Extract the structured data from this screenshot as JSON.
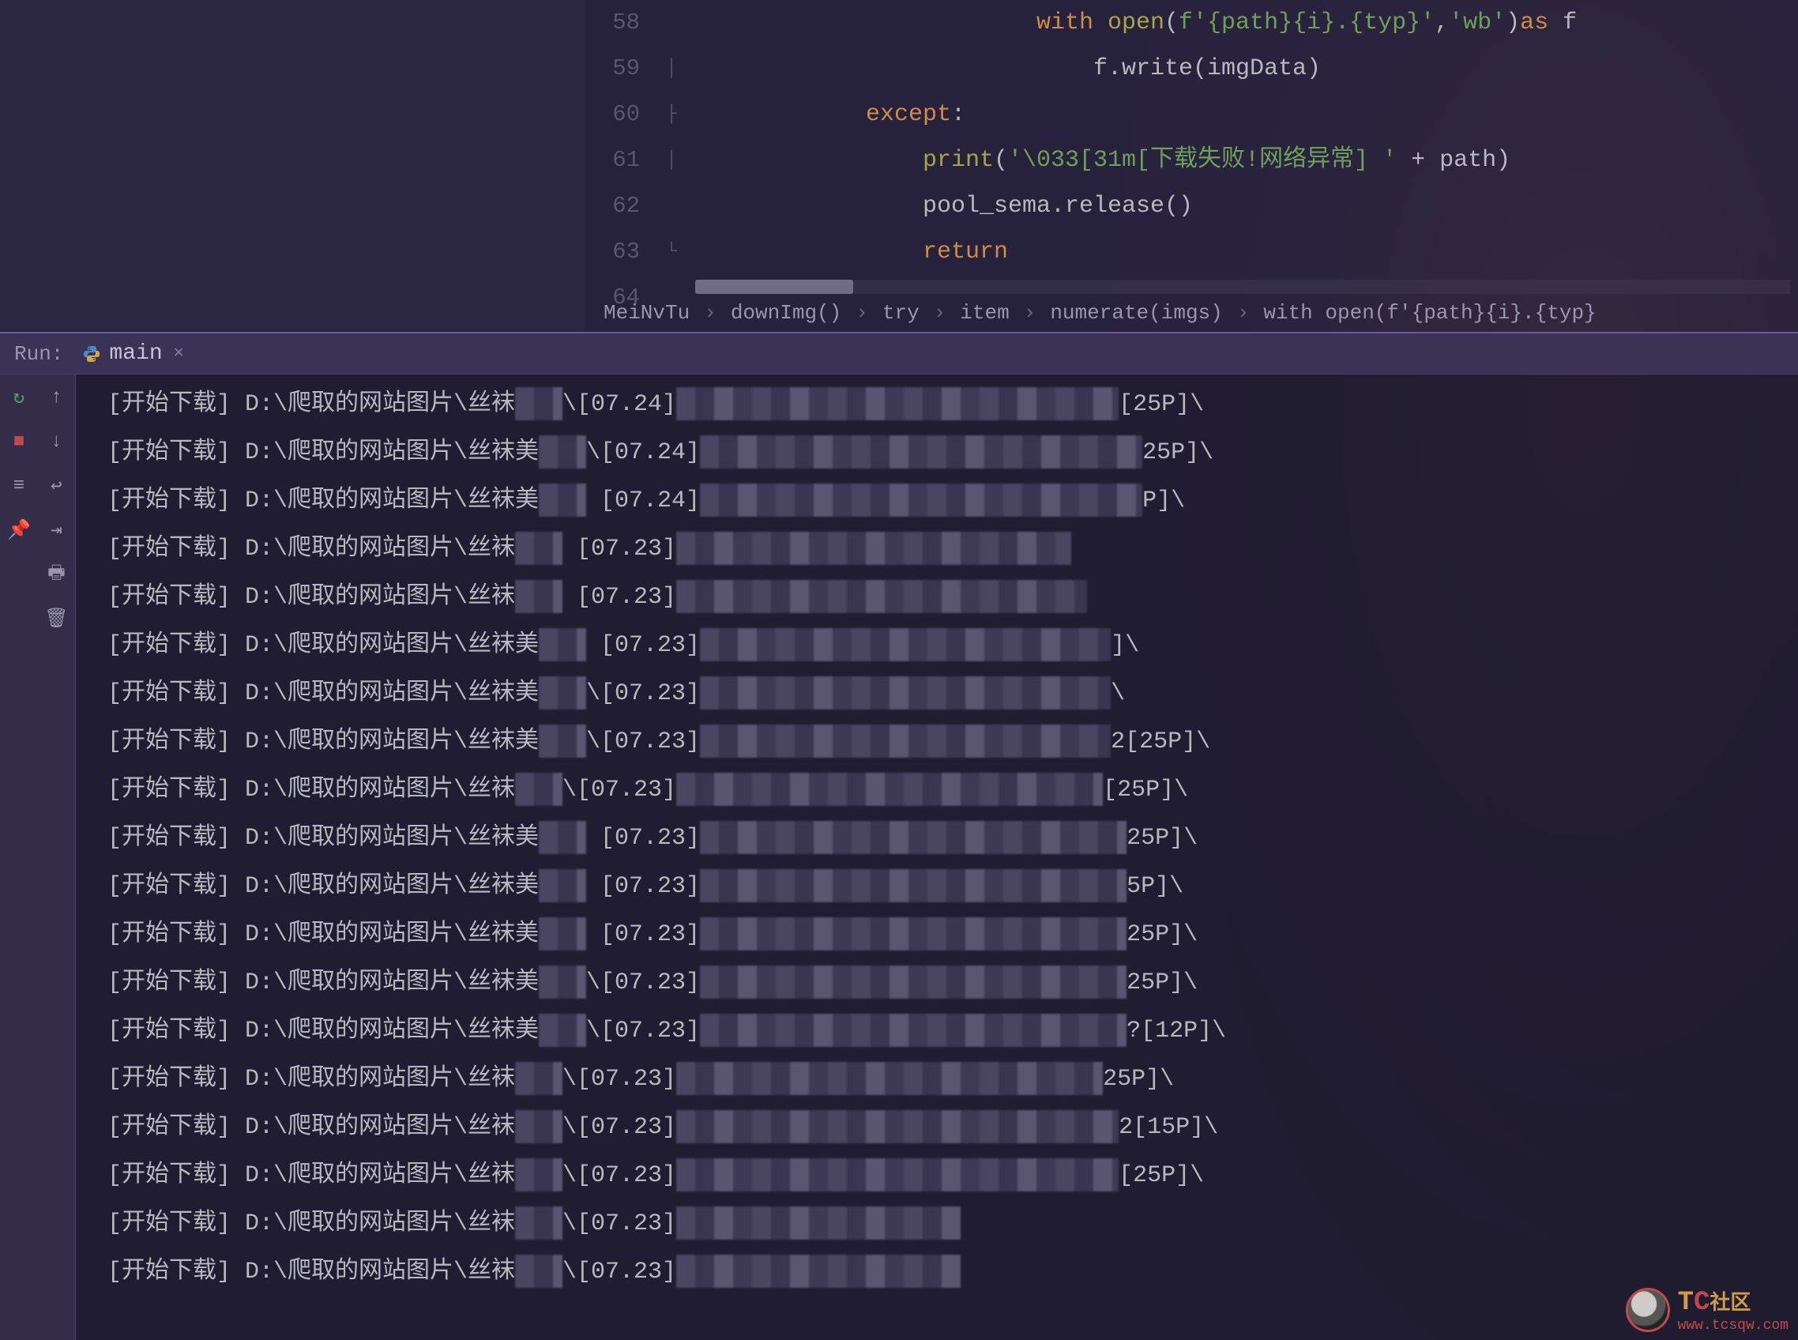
{
  "editor": {
    "lines": [
      {
        "num": "58",
        "fold": "",
        "indent": 24,
        "tokens": [
          {
            "t": "with ",
            "c": "kw"
          },
          {
            "t": "open",
            "c": "fn"
          },
          {
            "t": "(",
            "c": "id"
          },
          {
            "t": "f'{path}{i}.{typ}'",
            "c": "str"
          },
          {
            "t": ",",
            "c": "id"
          },
          {
            "t": "'wb'",
            "c": "str"
          },
          {
            "t": ")",
            "c": "id"
          },
          {
            "t": "as ",
            "c": "kw"
          },
          {
            "t": "f",
            "c": "id"
          }
        ]
      },
      {
        "num": "59",
        "fold": "│",
        "indent": 28,
        "tokens": [
          {
            "t": "f.write(imgData)",
            "c": "id"
          }
        ]
      },
      {
        "num": "60",
        "fold": "├",
        "indent": 12,
        "tokens": [
          {
            "t": "except",
            "c": "kw"
          },
          {
            "t": ":",
            "c": "id"
          }
        ]
      },
      {
        "num": "61",
        "fold": "│",
        "indent": 16,
        "tokens": [
          {
            "t": "print",
            "c": "fn"
          },
          {
            "t": "(",
            "c": "id"
          },
          {
            "t": "'\\033[31m[下载失败!网络异常] '",
            "c": "str"
          },
          {
            "t": " + path)",
            "c": "id"
          }
        ]
      },
      {
        "num": "62",
        "fold": "",
        "indent": 16,
        "tokens": [
          {
            "t": "pool_sema.release()",
            "c": "id"
          }
        ]
      },
      {
        "num": "63",
        "fold": "└",
        "indent": 16,
        "tokens": [
          {
            "t": "return",
            "c": "kw"
          }
        ]
      },
      {
        "num": "64",
        "fold": "",
        "indent": 0,
        "tokens": []
      }
    ],
    "breadcrumb": [
      "MeiNvTu",
      "downImg()",
      "try",
      "item",
      "numerate(imgs)",
      "with open(f'{path}{i}.{typ}"
    ]
  },
  "run": {
    "label": "Run:",
    "tab": "main",
    "lines": [
      {
        "prefix": "[开始下载] D:\\爬取的网站图片\\丝袜",
        "mid": "\\[07.24]",
        "cw": 560,
        "suffix": "[25P]\\"
      },
      {
        "prefix": "[开始下载] D:\\爬取的网站图片\\丝袜美",
        "mid": "\\[07.24]",
        "cw": 560,
        "suffix": "25P]\\"
      },
      {
        "prefix": "[开始下载] D:\\爬取的网站图片\\丝袜美",
        "mid": " [07.24]",
        "cw": 560,
        "suffix": "P]\\"
      },
      {
        "prefix": "[开始下载] D:\\爬取的网站图片\\丝袜",
        "mid": " [07.23]",
        "cw": 500,
        "suffix": ""
      },
      {
        "prefix": "[开始下载] D:\\爬取的网站图片\\丝袜",
        "mid": " [07.23]",
        "cw": 520,
        "suffix": ""
      },
      {
        "prefix": "[开始下载] D:\\爬取的网站图片\\丝袜美",
        "mid": " [07.23]",
        "cw": 520,
        "suffix": "]\\"
      },
      {
        "prefix": "[开始下载] D:\\爬取的网站图片\\丝袜美",
        "mid": "\\[07.23]",
        "cw": 520,
        "suffix": "\\"
      },
      {
        "prefix": "[开始下载] D:\\爬取的网站图片\\丝袜美",
        "mid": "\\[07.23]",
        "cw": 520,
        "suffix": "2[25P]\\"
      },
      {
        "prefix": "[开始下载] D:\\爬取的网站图片\\丝袜",
        "mid": "\\[07.23]",
        "cw": 540,
        "suffix": "[25P]\\"
      },
      {
        "prefix": "[开始下载] D:\\爬取的网站图片\\丝袜美",
        "mid": " [07.23]",
        "cw": 540,
        "suffix": "25P]\\"
      },
      {
        "prefix": "[开始下载] D:\\爬取的网站图片\\丝袜美",
        "mid": " [07.23]",
        "cw": 540,
        "suffix": "5P]\\"
      },
      {
        "prefix": "[开始下载] D:\\爬取的网站图片\\丝袜美",
        "mid": " [07.23]",
        "cw": 540,
        "suffix": "25P]\\"
      },
      {
        "prefix": "[开始下载] D:\\爬取的网站图片\\丝袜美",
        "mid": "\\[07.23]",
        "cw": 540,
        "suffix": "25P]\\"
      },
      {
        "prefix": "[开始下载] D:\\爬取的网站图片\\丝袜美",
        "mid": "\\[07.23]",
        "cw": 540,
        "suffix": "?[12P]\\"
      },
      {
        "prefix": "[开始下载] D:\\爬取的网站图片\\丝袜",
        "mid": "\\[07.23]",
        "cw": 540,
        "suffix": "25P]\\"
      },
      {
        "prefix": "[开始下载] D:\\爬取的网站图片\\丝袜",
        "mid": "\\[07.23]",
        "cw": 560,
        "suffix": "2[15P]\\"
      },
      {
        "prefix": "[开始下载] D:\\爬取的网站图片\\丝袜",
        "mid": "\\[07.23]",
        "cw": 560,
        "suffix": "[25P]\\"
      },
      {
        "prefix": "[开始下载] D:\\爬取的网站图片\\丝袜",
        "mid": "\\[07.23]",
        "cw": 360,
        "suffix": ""
      },
      {
        "prefix": "[开始下载] D:\\爬取的网站图片\\丝袜",
        "mid": "\\[07.23]",
        "cw": 360,
        "suffix": ""
      }
    ]
  },
  "watermark": {
    "brand_t": "T",
    "brand_c": "C",
    "brand_suffix": "社区",
    "url": "www.tcsqw.com"
  },
  "tools1": [
    {
      "name": "rerun-icon",
      "glyph": "↻",
      "cls": "green"
    },
    {
      "name": "stop-icon",
      "glyph": "■",
      "cls": "red"
    },
    {
      "name": "layout-icon",
      "glyph": "≡",
      "cls": ""
    },
    {
      "name": "pin-icon",
      "glyph": "📌",
      "cls": ""
    }
  ],
  "tools2": [
    {
      "name": "up-arrow-icon",
      "glyph": "↑",
      "cls": ""
    },
    {
      "name": "down-arrow-icon",
      "glyph": "↓",
      "cls": ""
    },
    {
      "name": "wrap-icon",
      "glyph": "↩",
      "cls": ""
    },
    {
      "name": "scroll-end-icon",
      "glyph": "⇥",
      "cls": ""
    },
    {
      "name": "print-icon",
      "glyph": "🖶",
      "cls": ""
    },
    {
      "name": "trash-icon",
      "glyph": "🗑",
      "cls": ""
    }
  ]
}
